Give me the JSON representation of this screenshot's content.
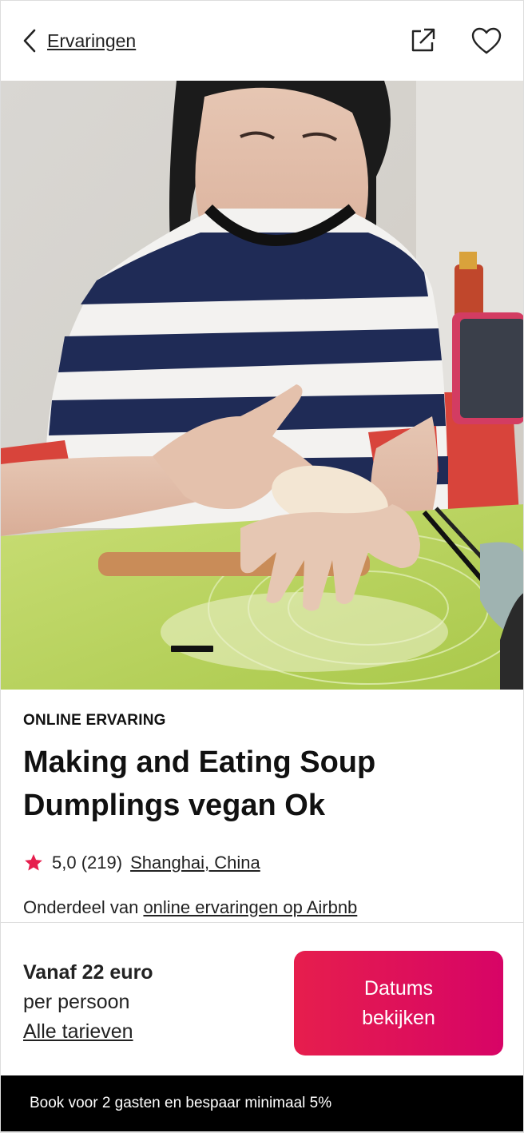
{
  "header": {
    "back_label": "Ervaringen",
    "icons": [
      "chevron-left-icon",
      "share-icon",
      "heart-icon"
    ]
  },
  "hero": {
    "carousel_current": 1
  },
  "listing": {
    "eyebrow": "ONLINE ERVARING",
    "title_line1": "Making and Eating Soup",
    "title_line2": "Dumplings vegan Ok",
    "rating": "5,0",
    "reviews": "(219)",
    "location": "Shanghai, China",
    "part_of_prefix": "Onderdeel van ",
    "part_of_link": "online ervaringen op Airbnb"
  },
  "booking": {
    "price_from": "Vanaf 22 euro",
    "per_person": "per persoon",
    "all_rates": "Alle tarieven",
    "cta_line1": "Datums",
    "cta_line2": "bekijken"
  },
  "promo": {
    "text": "Book voor 2 gasten en bespaar minimaal 5%"
  },
  "colors": {
    "accent_start": "#e61e4d",
    "accent_end": "#d70466",
    "star": "#e61e4d",
    "text": "#222222",
    "promo_bg": "#000000"
  }
}
